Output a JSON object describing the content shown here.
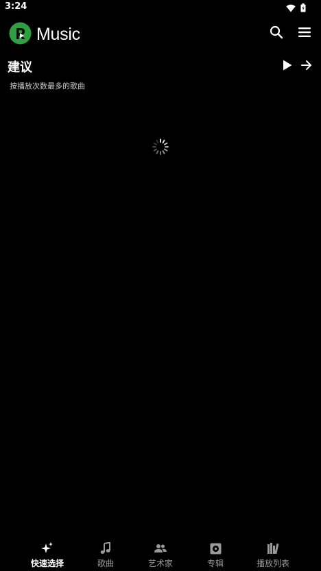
{
  "status_bar": {
    "time": "3:24",
    "icons": [
      "wifi-icon",
      "battery-icon"
    ]
  },
  "app_bar": {
    "title": "Music",
    "logo_icon": "music-logo-icon",
    "actions": [
      "search-icon",
      "menu-icon"
    ]
  },
  "section": {
    "title": "建议",
    "subtitle": "按播放次数最多的歌曲",
    "actions": [
      "play-icon",
      "arrow-right-icon"
    ]
  },
  "loading": {
    "icon": "loading-spinner-icon"
  },
  "bottom_nav": {
    "items": [
      {
        "label": "快速选择",
        "icon": "sparkle-icon",
        "active": true
      },
      {
        "label": "歌曲",
        "icon": "music-note-icon",
        "active": false
      },
      {
        "label": "艺术家",
        "icon": "artists-icon",
        "active": false
      },
      {
        "label": "专辑",
        "icon": "album-icon",
        "active": false
      },
      {
        "label": "播放列表",
        "icon": "library-icon",
        "active": false
      }
    ]
  },
  "colors": {
    "background": "#000000",
    "brand_green": "#2ea043",
    "text_primary": "#ffffff",
    "text_secondary": "#cfcfcf",
    "nav_inactive": "#9a9a9a"
  }
}
